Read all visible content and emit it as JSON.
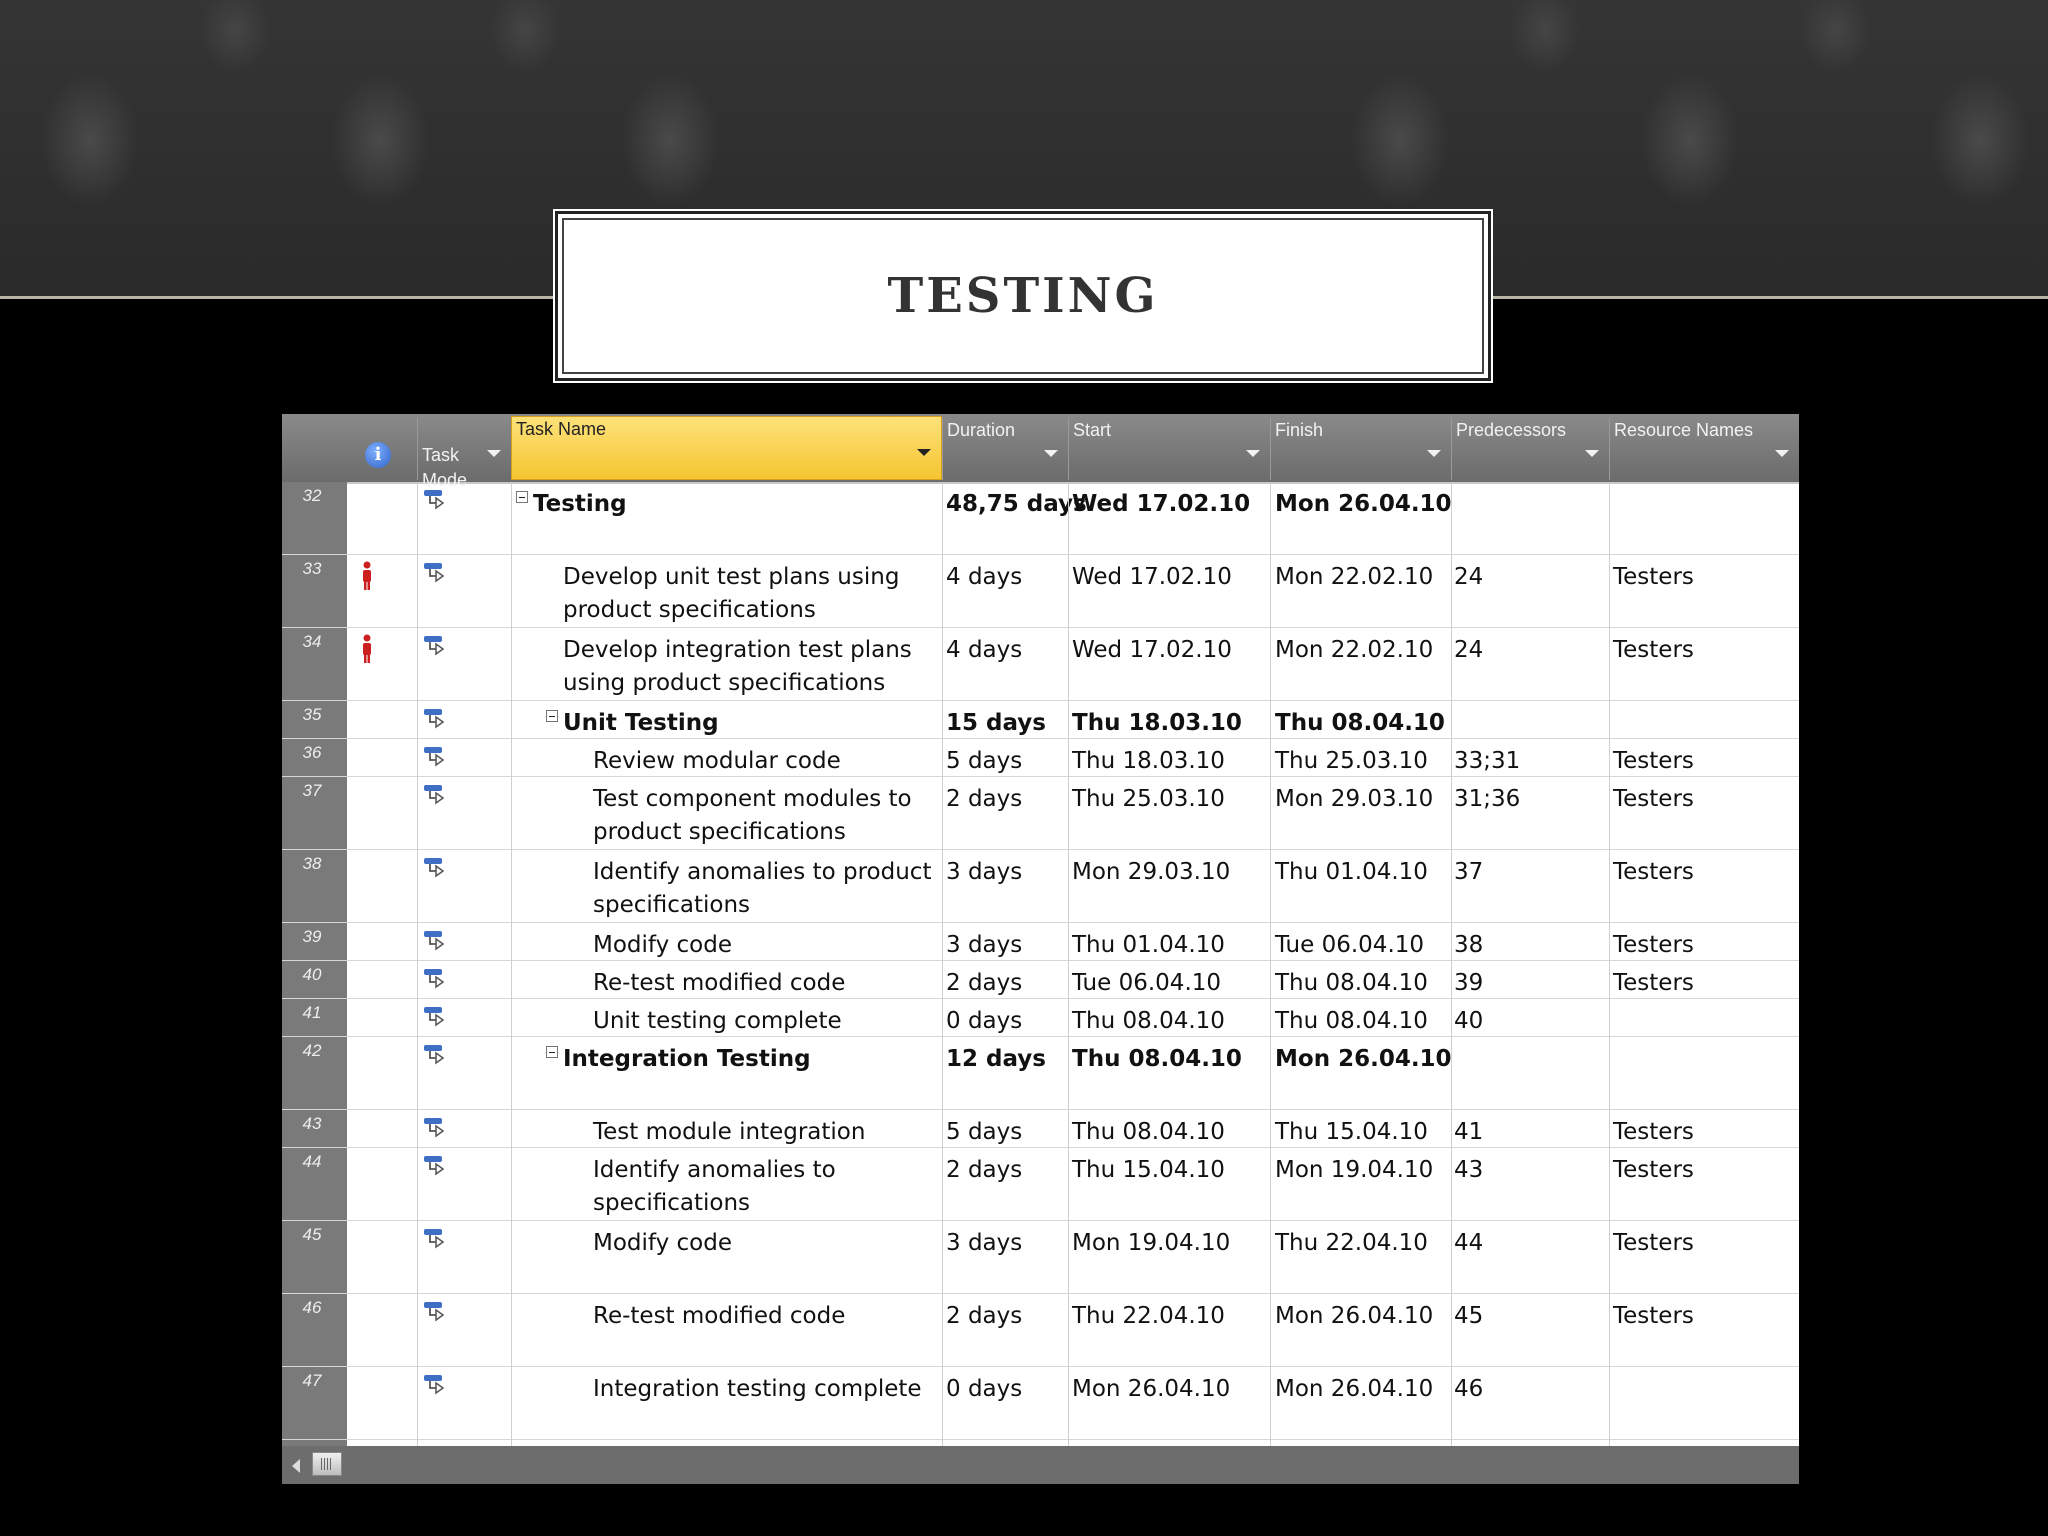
{
  "slide": {
    "title": "TESTING"
  },
  "grid": {
    "columns": {
      "info": "i",
      "task_mode": "Task\nMode",
      "task_name": "Task Name",
      "duration": "Duration",
      "start": "Start",
      "finish": "Finish",
      "predecessors": "Predecessors",
      "resource_names": "Resource Names"
    },
    "rows": [
      {
        "id": "32",
        "name": "Testing",
        "duration": "48,75 days",
        "start": "Wed 17.02.10",
        "finish": "Mon 26.04.10",
        "pred": "",
        "res": "",
        "level": 0,
        "summary": true,
        "indicator": false
      },
      {
        "id": "33",
        "name": "Develop unit test plans using\nproduct specifications",
        "duration": "4 days",
        "start": "Wed 17.02.10",
        "finish": "Mon 22.02.10",
        "pred": "24",
        "res": "Testers",
        "level": 1,
        "summary": false,
        "indicator": true
      },
      {
        "id": "34",
        "name": "Develop integration test plans\nusing product specifications",
        "duration": "4 days",
        "start": "Wed 17.02.10",
        "finish": "Mon 22.02.10",
        "pred": "24",
        "res": "Testers",
        "level": 1,
        "summary": false,
        "indicator": true
      },
      {
        "id": "35",
        "name": "Unit Testing",
        "duration": "15 days",
        "start": "Thu 18.03.10",
        "finish": "Thu 08.04.10",
        "pred": "",
        "res": "",
        "level": 1,
        "summary": true,
        "indicator": false
      },
      {
        "id": "36",
        "name": "Review modular code",
        "duration": "5 days",
        "start": "Thu 18.03.10",
        "finish": "Thu 25.03.10",
        "pred": "33;31",
        "res": "Testers",
        "level": 2,
        "summary": false,
        "indicator": false
      },
      {
        "id": "37",
        "name": "Test component modules to\nproduct specifications",
        "duration": "2 days",
        "start": "Thu 25.03.10",
        "finish": "Mon 29.03.10",
        "pred": "31;36",
        "res": "Testers",
        "level": 2,
        "summary": false,
        "indicator": false
      },
      {
        "id": "38",
        "name": "Identify anomalies to product\nspecifications",
        "duration": "3 days",
        "start": "Mon 29.03.10",
        "finish": "Thu 01.04.10",
        "pred": "37",
        "res": "Testers",
        "level": 2,
        "summary": false,
        "indicator": false
      },
      {
        "id": "39",
        "name": "Modify code",
        "duration": "3 days",
        "start": "Thu 01.04.10",
        "finish": "Tue 06.04.10",
        "pred": "38",
        "res": "Testers",
        "level": 2,
        "summary": false,
        "indicator": false
      },
      {
        "id": "40",
        "name": "Re-test modified code",
        "duration": "2 days",
        "start": "Tue 06.04.10",
        "finish": "Thu 08.04.10",
        "pred": "39",
        "res": "Testers",
        "level": 2,
        "summary": false,
        "indicator": false
      },
      {
        "id": "41",
        "name": "Unit testing complete",
        "duration": "0 days",
        "start": "Thu 08.04.10",
        "finish": "Thu 08.04.10",
        "pred": "40",
        "res": "",
        "level": 2,
        "summary": false,
        "indicator": false
      },
      {
        "id": "42",
        "name": "Integration Testing",
        "duration": "12 days",
        "start": "Thu 08.04.10",
        "finish": "Mon 26.04.10",
        "pred": "",
        "res": "",
        "level": 1,
        "summary": true,
        "indicator": false
      },
      {
        "id": "43",
        "name": "Test module integration",
        "duration": "5 days",
        "start": "Thu 08.04.10",
        "finish": "Thu 15.04.10",
        "pred": "41",
        "res": "Testers",
        "level": 2,
        "summary": false,
        "indicator": false
      },
      {
        "id": "44",
        "name": "Identify anomalies to\nspecifications",
        "duration": "2 days",
        "start": "Thu 15.04.10",
        "finish": "Mon 19.04.10",
        "pred": "43",
        "res": "Testers",
        "level": 2,
        "summary": false,
        "indicator": false
      },
      {
        "id": "45",
        "name": "Modify code",
        "duration": "3 days",
        "start": "Mon 19.04.10",
        "finish": "Thu 22.04.10",
        "pred": "44",
        "res": "Testers",
        "level": 2,
        "summary": false,
        "indicator": false
      },
      {
        "id": "46",
        "name": "Re-test modified code",
        "duration": "2 days",
        "start": "Thu 22.04.10",
        "finish": "Mon 26.04.10",
        "pred": "45",
        "res": "Testers",
        "level": 2,
        "summary": false,
        "indicator": false
      },
      {
        "id": "47",
        "name": "Integration testing complete",
        "duration": "0 days",
        "start": "Mon 26.04.10",
        "finish": "Mon 26.04.10",
        "pred": "46",
        "res": "",
        "level": 2,
        "summary": false,
        "indicator": false
      }
    ]
  },
  "colors": {
    "header_bg": "#6b6b6b",
    "selected_header": "#f5c531",
    "indicator": "#cc1f1f",
    "task_mode_icon": "#3e6fc4"
  },
  "icons": {
    "info": "info-icon",
    "task_mode": "auto-scheduled-task-icon",
    "indicator": "person-indicator-icon",
    "collapse": "collapse-minus-icon",
    "dropdown": "dropdown-arrow-icon"
  }
}
